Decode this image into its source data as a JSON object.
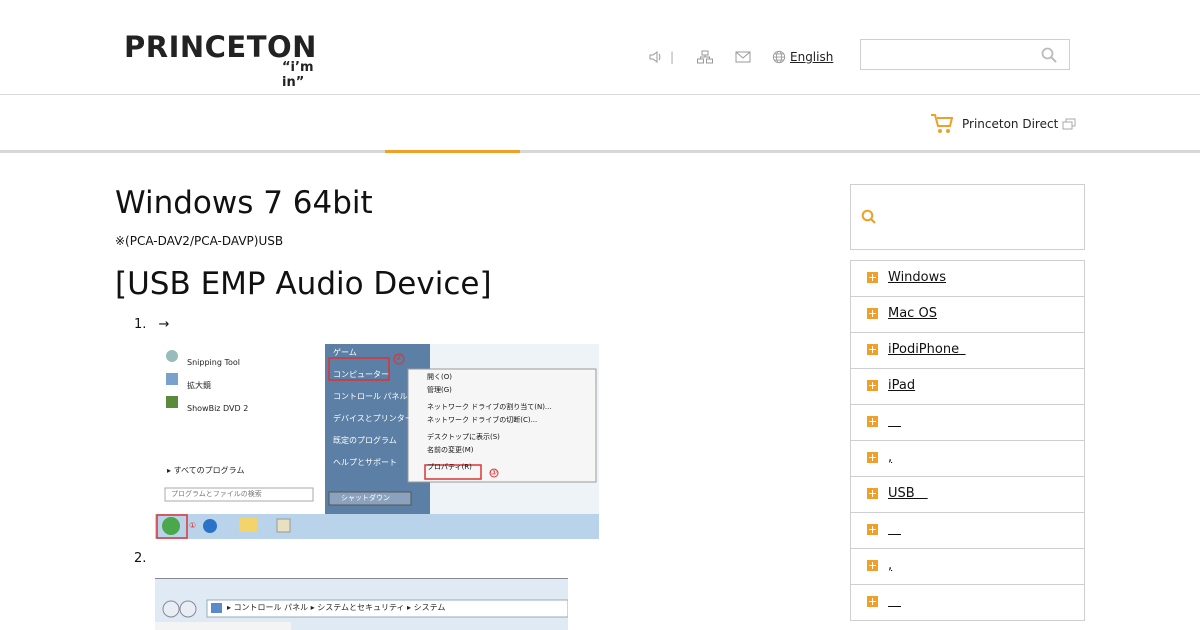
{
  "header": {
    "logo_text": "PRINCETON",
    "logo_tagline": "“i’m in”",
    "utility": {
      "separator": "|",
      "language_label": "English"
    },
    "search": {
      "placeholder": ""
    }
  },
  "nav": {
    "direct_label": "Princeton Direct"
  },
  "main": {
    "title": "Windows 7 64bit",
    "note": "※(PCA-DAV2/PCA-DAVP)USB",
    "section_title": "[USB EMP Audio Device]",
    "steps": [
      {
        "number": "1.",
        "text": "→"
      },
      {
        "number": "2.",
        "text": ""
      }
    ],
    "shot1": {
      "left_items": [
        "Snipping Tool",
        "拡大鏡",
        "ShowBiz DVD 2"
      ],
      "all_programs": "すべてのプログラム",
      "search_placeholder": "プログラムとファイルの検索",
      "right_items": [
        "ゲーム",
        "コンピューター",
        "コントロール パネル",
        "デバイスとプリンター",
        "既定のプログラム",
        "ヘルプとサポート"
      ],
      "shutdown": "シャットダウン",
      "context_menu": [
        "開く(O)",
        "管理(G)",
        "ネットワーク ドライブの割り当て(N)...",
        "ネットワーク ドライブの切断(C)...",
        "デスクトップに表示(S)",
        "名前の変更(M)",
        "プロパティ(R)"
      ],
      "markers": [
        "①",
        "②",
        "③"
      ]
    },
    "shot2": {
      "breadcrumb": [
        "コントロール パネル",
        "システムとセキュリティ",
        "システム"
      ]
    }
  },
  "sidebar": {
    "search_placeholder": "",
    "categories": [
      {
        "label": "Windows"
      },
      {
        "label": "Mac OS"
      },
      {
        "label": "iPodiPhone "
      },
      {
        "label": "iPad"
      },
      {
        "label": " "
      },
      {
        "label": ","
      },
      {
        "label": "USB "
      },
      {
        "label": " "
      },
      {
        "label": ","
      },
      {
        "label": " "
      }
    ]
  },
  "colors": {
    "accent": "#f0a026",
    "border": "#cfcfcf"
  }
}
